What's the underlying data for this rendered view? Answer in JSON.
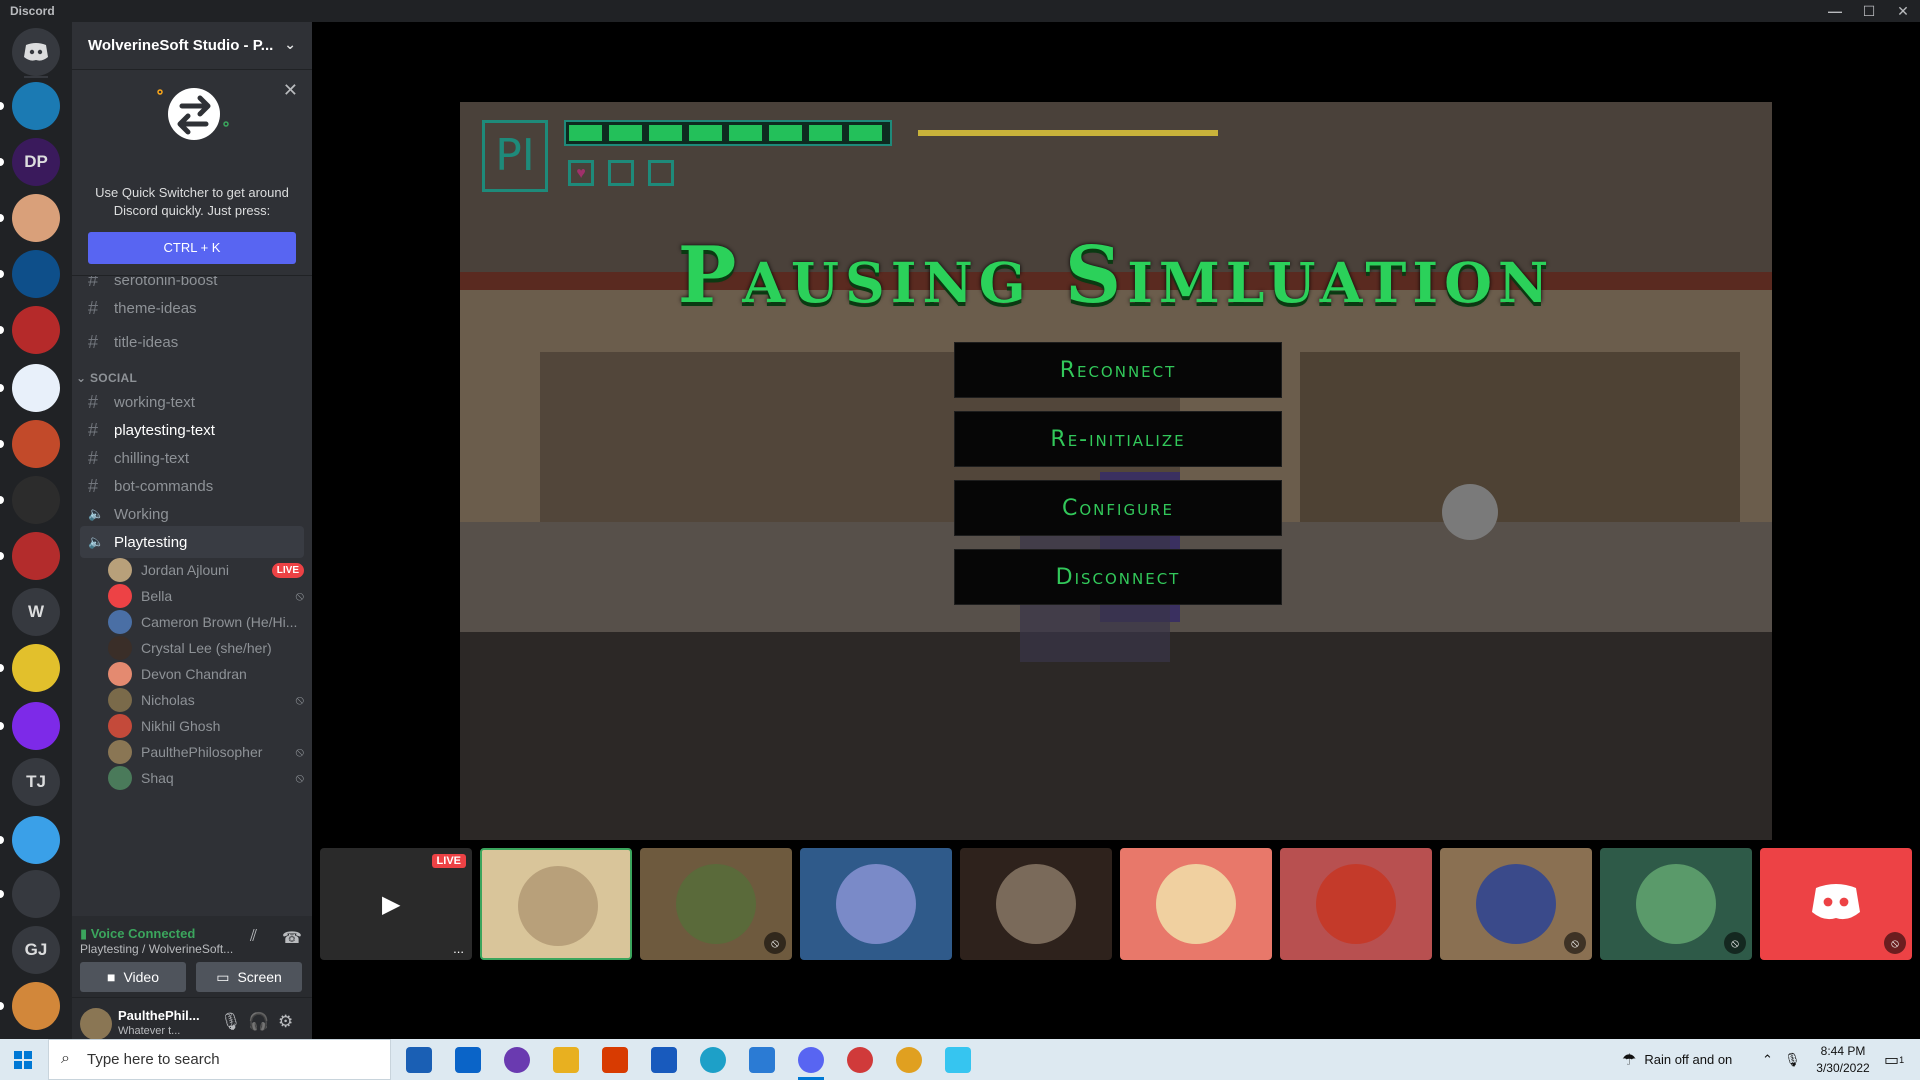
{
  "window": {
    "title": "Discord",
    "controls": [
      "—",
      "☐",
      "✕"
    ]
  },
  "guilds": [
    {
      "label": "",
      "icon": "discord-logo-icon",
      "bg": "#36393f"
    },
    {
      "label": "",
      "bg": "#1b7ab3"
    },
    {
      "label": "DP",
      "bg": "#3a1a5c"
    },
    {
      "label": "",
      "bg": "#d9a07a"
    },
    {
      "label": "",
      "bg": "#0e4f8a"
    },
    {
      "label": "",
      "bg": "#b52a2a"
    },
    {
      "label": "",
      "bg": "#e8f0fa"
    },
    {
      "label": "",
      "bg": "#c24a2a"
    },
    {
      "label": "",
      "bg": "#2c2c2c"
    },
    {
      "label": "",
      "bg": "#b32c2c"
    },
    {
      "label": "W",
      "bg": "#36393f"
    },
    {
      "label": "",
      "bg": "#e2c02c"
    },
    {
      "label": "",
      "bg": "#7d2ae8"
    },
    {
      "label": "TJ",
      "bg": "#36393f"
    },
    {
      "label": "",
      "bg": "#3aa0e8"
    },
    {
      "label": "",
      "bg": "#36393f"
    },
    {
      "label": "GJ",
      "bg": "#36393f"
    },
    {
      "label": "",
      "bg": "#d2873a"
    }
  ],
  "server": {
    "name": "WolverineSoft Studio - P..."
  },
  "quick_switcher": {
    "text": "Use Quick Switcher to get around Discord quickly. Just press:",
    "shortcut": "CTRL + K"
  },
  "channels_top": [
    "serotonin-boost",
    "theme-ideas",
    "title-ideas"
  ],
  "category": "SOCIAL",
  "channels_social": [
    {
      "name": "working-text",
      "type": "text",
      "state": ""
    },
    {
      "name": "playtesting-text",
      "type": "text",
      "state": "unread"
    },
    {
      "name": "chilling-text",
      "type": "text",
      "state": ""
    },
    {
      "name": "bot-commands",
      "type": "text",
      "state": ""
    },
    {
      "name": "Working",
      "type": "voice",
      "state": ""
    },
    {
      "name": "Playtesting",
      "type": "voice",
      "state": "active"
    }
  ],
  "voice_users": [
    {
      "name": "Jordan Ajlouni",
      "badge": "LIVE",
      "muted": false,
      "color": "#b8a07a"
    },
    {
      "name": "Bella",
      "badge": "",
      "muted": true,
      "color": "#ed4245"
    },
    {
      "name": "Cameron Brown (He/Hi...",
      "badge": "",
      "muted": false,
      "color": "#4a6fa5"
    },
    {
      "name": "Crystal Lee (she/her)",
      "badge": "",
      "muted": false,
      "color": "#3a2e28"
    },
    {
      "name": "Devon Chandran",
      "badge": "",
      "muted": false,
      "color": "#e48a70"
    },
    {
      "name": "Nicholas",
      "badge": "",
      "muted": true,
      "color": "#7a6a4a"
    },
    {
      "name": "Nikhil Ghosh",
      "badge": "",
      "muted": false,
      "color": "#c44a3a"
    },
    {
      "name": "PaulthePhilosopher",
      "badge": "",
      "muted": true,
      "color": "#8a7654"
    },
    {
      "name": "Shaq",
      "badge": "",
      "muted": true,
      "color": "#4a7a5a"
    }
  ],
  "voice_panel": {
    "status": "Voice Connected",
    "location": "Playtesting / WolverineSoft...",
    "video_label": "Video",
    "screen_label": "Screen"
  },
  "user_panel": {
    "name": "PaulthePhil...",
    "status": "Whatever t..."
  },
  "stream": {
    "title": "Pausing Simluation",
    "logo_text": "PI",
    "menu": [
      "Reconnect",
      "Re-initialize",
      "Configure",
      "Disconnect"
    ],
    "health_segments": 8
  },
  "tiles": [
    {
      "kind": "stream",
      "badge": "LIVE",
      "bg": "#2a2a2a",
      "muted": false,
      "selected": false,
      "more": "..."
    },
    {
      "kind": "avatar",
      "bg": "#d9c59a",
      "circle": "#b8a07a",
      "muted": false,
      "selected": true
    },
    {
      "kind": "avatar",
      "bg": "#6e5a3e",
      "circle": "#5a6a3a",
      "muted": true,
      "selected": false
    },
    {
      "kind": "avatar",
      "bg": "#2f5a8a",
      "circle": "#7a8ac8",
      "muted": false,
      "selected": false
    },
    {
      "kind": "avatar",
      "bg": "#2e221c",
      "circle": "#7a6a5a",
      "muted": false,
      "selected": false
    },
    {
      "kind": "avatar",
      "bg": "#e8786a",
      "circle": "#f0d0a0",
      "muted": false,
      "selected": false
    },
    {
      "kind": "avatar",
      "bg": "#b85050",
      "circle": "#c43a2a",
      "muted": false,
      "selected": false
    },
    {
      "kind": "avatar",
      "bg": "#8a7052",
      "circle": "#3a4a8a",
      "muted": true,
      "selected": false
    },
    {
      "kind": "avatar",
      "bg": "#2e5a48",
      "circle": "#5a9a6a",
      "muted": true,
      "selected": false
    },
    {
      "kind": "discord",
      "bg": "#ed4245",
      "muted": true,
      "selected": false
    }
  ],
  "taskbar": {
    "search_placeholder": "Type here to search",
    "weather": "Rain off and on",
    "time": "8:44 PM",
    "date": "3/30/2022",
    "notification_count": "1"
  },
  "colors": {
    "accent": "#5865f2",
    "green": "#3ba55d",
    "live_red": "#ed4245",
    "game_text": "#2bd15a"
  }
}
